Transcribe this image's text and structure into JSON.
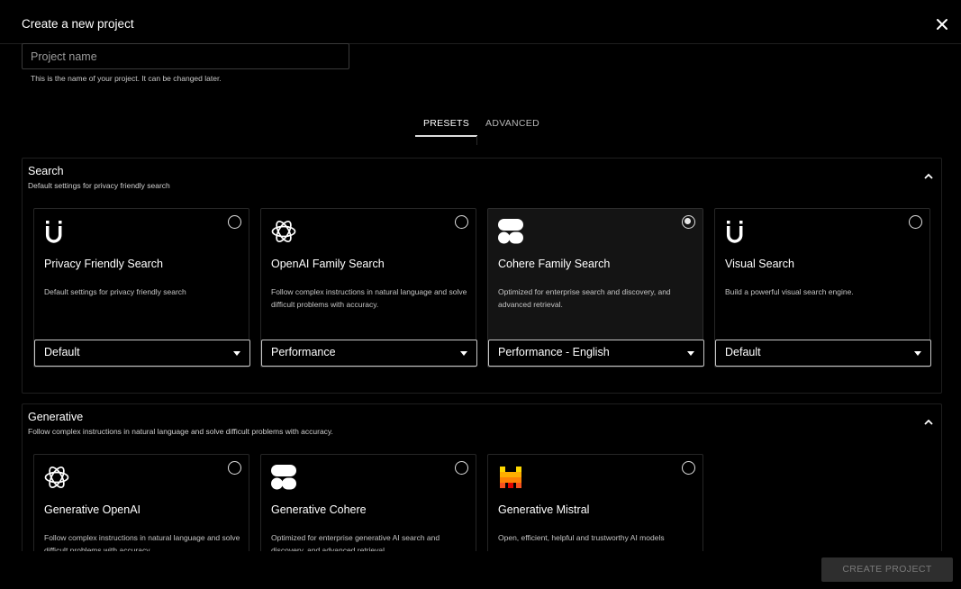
{
  "header": {
    "title": "Create a new project",
    "close_icon": "close-icon"
  },
  "name_field": {
    "placeholder": "Project name",
    "value": "",
    "help": "This is the name of your project. It can be changed later."
  },
  "tabs": [
    {
      "label": "PRESETS",
      "active": true
    },
    {
      "label": "ADVANCED",
      "active": false
    }
  ],
  "sections": {
    "search": {
      "title": "Search",
      "subtitle": "Default settings for privacy friendly search",
      "cards": [
        {
          "icon": "magnet-icon",
          "title": "Privacy Friendly Search",
          "description": "Default settings for privacy friendly search",
          "select": "Default",
          "selected": false
        },
        {
          "icon": "openai-icon",
          "title": "OpenAI Family Search",
          "description": "Follow complex instructions in natural language and solve difficult problems with accuracy.",
          "select": "Performance",
          "selected": false
        },
        {
          "icon": "cohere-icon",
          "title": "Cohere Family Search",
          "description": "Optimized for enterprise search and discovery, and advanced retrieval.",
          "select": "Performance - English",
          "selected": true
        },
        {
          "icon": "magnet-icon",
          "title": "Visual Search",
          "description": "Build a powerful visual search engine.",
          "select": "Default",
          "selected": false
        }
      ]
    },
    "generative": {
      "title": "Generative",
      "subtitle": "Follow complex instructions in natural language and solve difficult problems with accuracy.",
      "cards": [
        {
          "icon": "openai-icon",
          "title": "Generative OpenAI",
          "description": "Follow complex instructions in natural language and solve difficult problems with accuracy.",
          "selected": false
        },
        {
          "icon": "cohere-icon",
          "title": "Generative Cohere",
          "description": "Optimized for enterprise generative AI search and discovery, and advanced retrieval.",
          "selected": false
        },
        {
          "icon": "mistral-icon",
          "title": "Generative Mistral",
          "description": "Open, efficient, helpful and trustworthy AI models",
          "selected": false
        }
      ]
    }
  },
  "footer": {
    "create_label": "CREATE PROJECT"
  },
  "colors": {
    "background": "#000000",
    "selected_card": "#141414",
    "button_disabled": "#2e2e2e",
    "mistral_orange": "#f7521e",
    "mistral_yellow": "#ffae00"
  }
}
